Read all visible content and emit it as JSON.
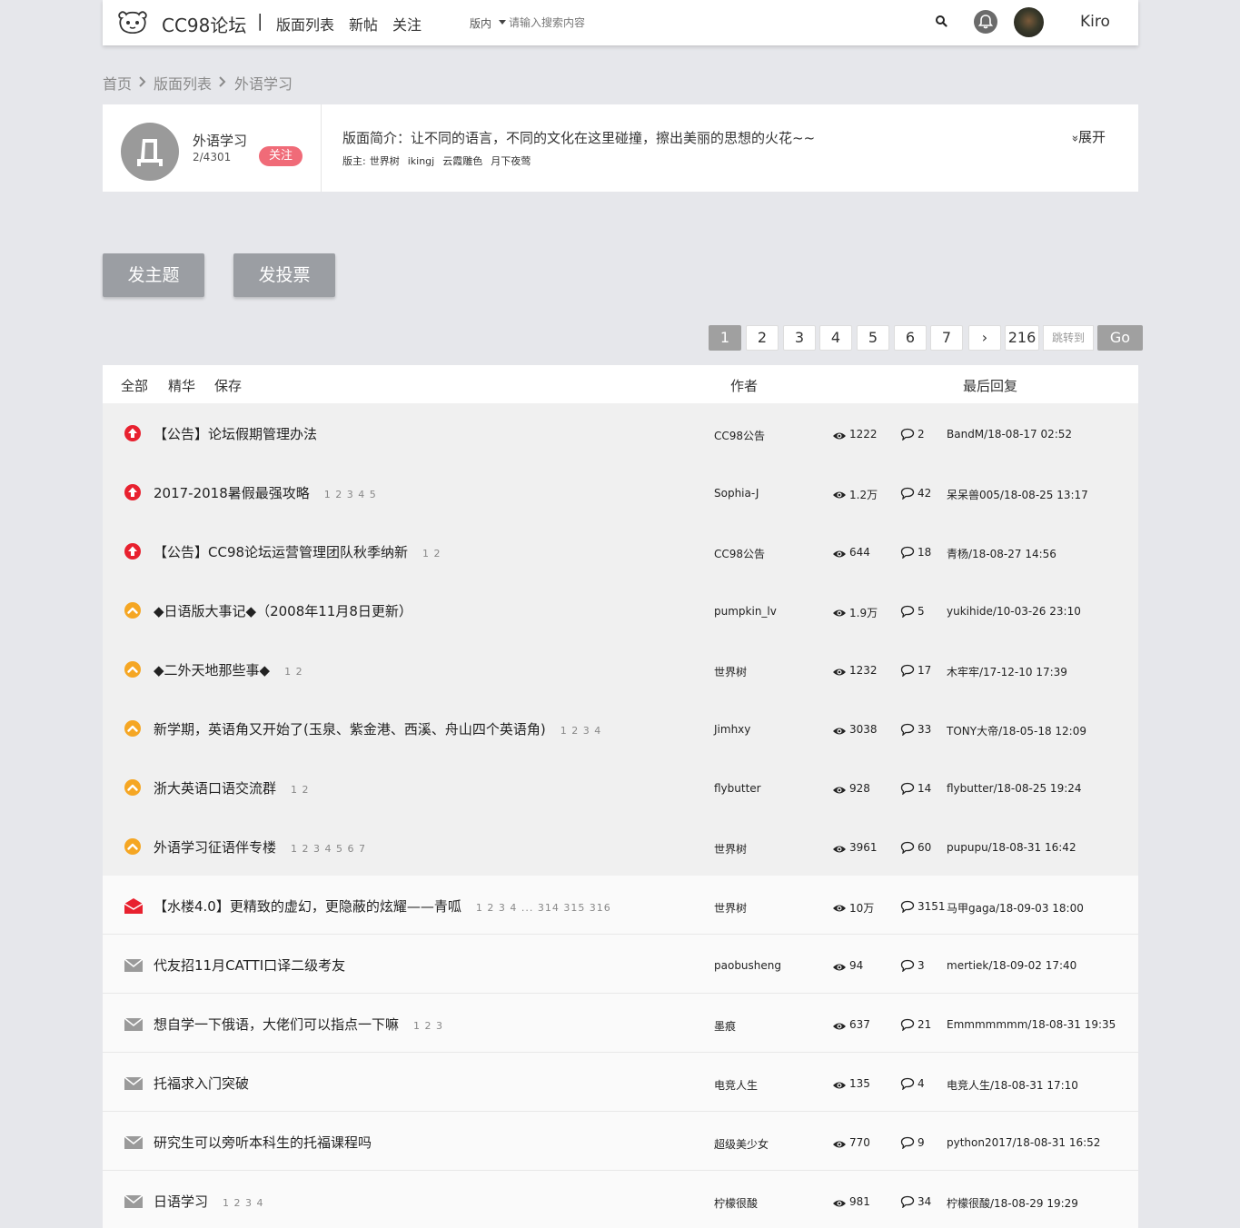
{
  "header": {
    "brand": "CC98论坛",
    "separator": "|",
    "nav": [
      "版面列表",
      "新帖",
      "关注"
    ],
    "search_scope": "版内",
    "search_placeholder": "请输入搜索内容",
    "username": "Kiro"
  },
  "breadcrumb": [
    "首页",
    "版面列表",
    "外语学习"
  ],
  "board": {
    "name": "外语学习",
    "count": "2/4301",
    "follow_label": "关注",
    "description": "版面简介：让不同的语言，不同的文化在这里碰撞，擦出美丽的思想的火花~~",
    "moderators_label": "版主:",
    "moderators": [
      "世界树",
      "ikingj",
      "云霞雕色",
      "月下夜莺"
    ],
    "expand_label": "展开",
    "expand_glyph": "»"
  },
  "actions": {
    "new_topic": "发主题",
    "new_vote": "发投票"
  },
  "pagination": {
    "pages": [
      "1",
      "2",
      "3",
      "4",
      "5",
      "6",
      "7",
      "›",
      "216"
    ],
    "jump_placeholder": "跳转到",
    "go_label": "Go"
  },
  "list": {
    "tabs": [
      "全部",
      "精华",
      "保存"
    ],
    "col_author": "作者",
    "col_last_reply": "最后回复",
    "topics": [
      {
        "kind": "pinned-global",
        "title": "【公告】论坛假期管理办法",
        "pages": "",
        "author": "CC98公告",
        "views": "1222",
        "replies": "2",
        "last": "BandM/18-08-17 02:52"
      },
      {
        "kind": "pinned-global",
        "title": "2017-2018暑假最强攻略",
        "pages": "1 2 3 4 5",
        "author": "Sophia-J",
        "views": "1.2万",
        "replies": "42",
        "last": "呆呆兽005/18-08-25 13:17"
      },
      {
        "kind": "pinned-global",
        "title": "【公告】CC98论坛运营管理团队秋季纳新",
        "pages": "1 2",
        "author": "CC98公告",
        "views": "644",
        "replies": "18",
        "last": "青杨/18-08-27 14:56"
      },
      {
        "kind": "pinned-board",
        "title": "◆日语版大事记◆（2008年11月8日更新）",
        "pages": "",
        "author": "pumpkin_lv",
        "views": "1.9万",
        "replies": "5",
        "last": "yukihide/10-03-26 23:10"
      },
      {
        "kind": "pinned-board",
        "title": "◆二外天地那些事◆",
        "pages": "1 2",
        "author": "世界树",
        "views": "1232",
        "replies": "17",
        "last": "木牢牢/17-12-10 17:39"
      },
      {
        "kind": "pinned-board",
        "title": "新学期，英语角又开始了(玉泉、紫金港、西溪、舟山四个英语角)",
        "pages": "1 2 3 4",
        "author": "Jimhxy",
        "views": "3038",
        "replies": "33",
        "last": "TONY大帝/18-05-18 12:09"
      },
      {
        "kind": "pinned-board",
        "title": "浙大英语口语交流群",
        "pages": "1 2",
        "author": "flybutter",
        "views": "928",
        "replies": "14",
        "last": "flybutter/18-08-25 19:24"
      },
      {
        "kind": "pinned-board",
        "title": "外语学习征语伴专楼",
        "pages": "1 2 3 4 5 6 7",
        "author": "世界树",
        "views": "3961",
        "replies": "60",
        "last": "pupupu/18-08-31 16:42"
      },
      {
        "kind": "hot",
        "title": "【水楼4.0】更精致的虚幻，更隐蔽的炫耀——青呱",
        "pages": "1 2 3 4 ... 314 315 316",
        "author": "世界树",
        "views": "10万",
        "replies": "3151",
        "last": "马甲gaga/18-09-03 18:00"
      },
      {
        "kind": "normal",
        "title": "代友招11月CATTI口译二级考友",
        "pages": "",
        "author": "paobusheng",
        "views": "94",
        "replies": "3",
        "last": "mertiek/18-09-02 17:40"
      },
      {
        "kind": "normal",
        "title": "想自学一下俄语，大佬们可以指点一下嘛",
        "pages": "1 2 3",
        "author": "墨痕",
        "views": "637",
        "replies": "21",
        "last": "Emmmmmmm/18-08-31 19:35"
      },
      {
        "kind": "normal",
        "title": "托福求入门突破",
        "pages": "",
        "author": "电竞人生",
        "views": "135",
        "replies": "4",
        "last": "电竞人生/18-08-31 17:10"
      },
      {
        "kind": "normal",
        "title": "研究生可以旁听本科生的托福课程吗",
        "pages": "",
        "author": "超级美少女",
        "views": "770",
        "replies": "9",
        "last": "python2017/18-08-31 16:52"
      },
      {
        "kind": "normal",
        "title": "日语学习",
        "pages": "1 2 3 4",
        "author": "柠檬很酸",
        "views": "981",
        "replies": "34",
        "last": "柠檬很酸/18-08-29 19:29"
      }
    ]
  },
  "colors": {
    "page_bg": "#e6e7eb",
    "pinned_global": "#e8212f",
    "pinned_board": "#f5a623",
    "hot": "#e8212f",
    "normal_icon": "#9a9a9a",
    "follow_btn": "#f06b78",
    "button_gray": "#9b9ea3"
  },
  "icons": {
    "logo": "cc98-logo-icon",
    "search": "search-icon",
    "bell": "bell-icon",
    "crumb_sep": "chevron-right-icon",
    "pinned_global": "arrow-up-circle-icon",
    "pinned_board": "chevron-up-circle-icon",
    "hot": "open-envelope-icon",
    "normal": "envelope-icon",
    "views": "eye-icon",
    "replies": "comment-icon"
  }
}
